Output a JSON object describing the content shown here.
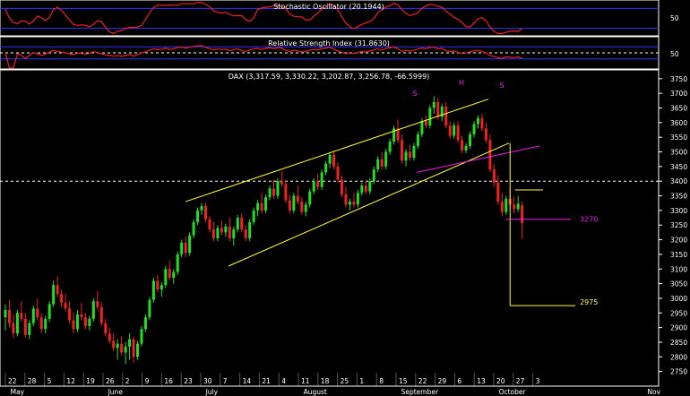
{
  "colors": {
    "background": "#000000",
    "up_candle": "#22dd22",
    "down_candle": "#ee2222",
    "trendline": "#ffff33",
    "neckline": "#ee22ee",
    "indicator_line": "#ee2222",
    "indicator_band": "#3333ff",
    "text": "#ffffff"
  },
  "chart_data": [
    {
      "type": "line",
      "title": "Stochastic Oscillator (20.1944)",
      "last_value": 20.1944,
      "ylim": [
        0,
        100
      ],
      "reference_levels": [
        20,
        80
      ],
      "ytick_labels": [
        "50"
      ]
    },
    {
      "type": "line",
      "title": "Relative Strength Index (31.8630)",
      "last_value": 31.863,
      "ylim": [
        0,
        100
      ],
      "reference_levels": [
        30,
        50,
        70
      ],
      "ytick_labels": [
        "50"
      ]
    },
    {
      "type": "candlestick",
      "title": "DAX (3,317.59, 3,330.22, 3,202.87, 3,256.78, -66.5999)",
      "last_bar": {
        "open": 3317.59,
        "high": 3330.22,
        "low": 3202.87,
        "close": 3256.78,
        "change": -66.5999
      },
      "ylim": [
        2700,
        3780
      ],
      "yticks": [
        2750,
        2800,
        2850,
        2900,
        2950,
        3000,
        3050,
        3100,
        3150,
        3200,
        3250,
        3300,
        3350,
        3400,
        3450,
        3500,
        3550,
        3600,
        3650,
        3700,
        3750
      ],
      "horizontal_reference": 3400,
      "x_day_labels": [
        "22",
        "28",
        "5",
        "12",
        "19",
        "26",
        "2",
        "9",
        "16",
        "23",
        "30",
        "7",
        "14",
        "21",
        "4",
        "11",
        "18",
        "25",
        "1",
        "8",
        "15",
        "22",
        "29",
        "6",
        "13",
        "20",
        "27",
        "3"
      ],
      "x_month_labels": [
        "May",
        "June",
        "July",
        "August",
        "September",
        "October",
        "Nov"
      ],
      "pattern_labels": [
        "S",
        "H",
        "S"
      ],
      "annotations": [
        {
          "label": "3270",
          "value": 3270
        },
        {
          "label": "2975",
          "value": 2975
        }
      ],
      "candles": [
        {
          "o": 2935,
          "h": 2980,
          "l": 2890,
          "c": 2960
        },
        {
          "o": 2960,
          "h": 2995,
          "l": 2900,
          "c": 2915
        },
        {
          "o": 2915,
          "h": 2945,
          "l": 2865,
          "c": 2880
        },
        {
          "o": 2880,
          "h": 2960,
          "l": 2870,
          "c": 2950
        },
        {
          "o": 2950,
          "h": 2990,
          "l": 2920,
          "c": 2930
        },
        {
          "o": 2930,
          "h": 2950,
          "l": 2865,
          "c": 2875
        },
        {
          "o": 2875,
          "h": 2925,
          "l": 2860,
          "c": 2915
        },
        {
          "o": 2915,
          "h": 2975,
          "l": 2905,
          "c": 2965
        },
        {
          "o": 2965,
          "h": 3000,
          "l": 2925,
          "c": 2935
        },
        {
          "o": 2935,
          "h": 2950,
          "l": 2880,
          "c": 2895
        },
        {
          "o": 2895,
          "h": 2940,
          "l": 2880,
          "c": 2930
        },
        {
          "o": 2930,
          "h": 2990,
          "l": 2920,
          "c": 2980
        },
        {
          "o": 2980,
          "h": 3060,
          "l": 2970,
          "c": 3045
        },
        {
          "o": 3045,
          "h": 3075,
          "l": 3005,
          "c": 3015
        },
        {
          "o": 3015,
          "h": 3030,
          "l": 2970,
          "c": 2985
        },
        {
          "o": 2985,
          "h": 3015,
          "l": 2955,
          "c": 2965
        },
        {
          "o": 2965,
          "h": 2990,
          "l": 2915,
          "c": 2925
        },
        {
          "o": 2925,
          "h": 2950,
          "l": 2880,
          "c": 2895
        },
        {
          "o": 2895,
          "h": 2960,
          "l": 2885,
          "c": 2945
        },
        {
          "o": 2945,
          "h": 2985,
          "l": 2925,
          "c": 2935
        },
        {
          "o": 2935,
          "h": 2950,
          "l": 2895,
          "c": 2905
        },
        {
          "o": 2905,
          "h": 2940,
          "l": 2890,
          "c": 2930
        },
        {
          "o": 2930,
          "h": 3000,
          "l": 2920,
          "c": 2990
        },
        {
          "o": 2990,
          "h": 3025,
          "l": 2960,
          "c": 2970
        },
        {
          "o": 2970,
          "h": 2985,
          "l": 2905,
          "c": 2915
        },
        {
          "o": 2915,
          "h": 2930,
          "l": 2870,
          "c": 2880
        },
        {
          "o": 2880,
          "h": 2900,
          "l": 2845,
          "c": 2855
        },
        {
          "o": 2855,
          "h": 2880,
          "l": 2820,
          "c": 2830
        },
        {
          "o": 2830,
          "h": 2860,
          "l": 2790,
          "c": 2845
        },
        {
          "o": 2845,
          "h": 2870,
          "l": 2805,
          "c": 2815
        },
        {
          "o": 2815,
          "h": 2850,
          "l": 2775,
          "c": 2835
        },
        {
          "o": 2835,
          "h": 2880,
          "l": 2790,
          "c": 2860
        },
        {
          "o": 2860,
          "h": 2870,
          "l": 2780,
          "c": 2800
        },
        {
          "o": 2800,
          "h": 2855,
          "l": 2790,
          "c": 2845
        },
        {
          "o": 2845,
          "h": 2905,
          "l": 2835,
          "c": 2895
        },
        {
          "o": 2895,
          "h": 2945,
          "l": 2885,
          "c": 2935
        },
        {
          "o": 2935,
          "h": 3005,
          "l": 2925,
          "c": 2995
        },
        {
          "o": 2995,
          "h": 3070,
          "l": 2985,
          "c": 3060
        },
        {
          "o": 3060,
          "h": 3080,
          "l": 3020,
          "c": 3030
        },
        {
          "o": 3030,
          "h": 3055,
          "l": 3005,
          "c": 3045
        },
        {
          "o": 3045,
          "h": 3110,
          "l": 3035,
          "c": 3100
        },
        {
          "o": 3100,
          "h": 3130,
          "l": 3060,
          "c": 3070
        },
        {
          "o": 3070,
          "h": 3100,
          "l": 3050,
          "c": 3090
        },
        {
          "o": 3090,
          "h": 3160,
          "l": 3080,
          "c": 3150
        },
        {
          "o": 3150,
          "h": 3200,
          "l": 3140,
          "c": 3190
        },
        {
          "o": 3190,
          "h": 3210,
          "l": 3140,
          "c": 3155
        },
        {
          "o": 3155,
          "h": 3225,
          "l": 3145,
          "c": 3215
        },
        {
          "o": 3215,
          "h": 3270,
          "l": 3205,
          "c": 3260
        },
        {
          "o": 3260,
          "h": 3310,
          "l": 3250,
          "c": 3300
        },
        {
          "o": 3300,
          "h": 3325,
          "l": 3285,
          "c": 3315
        },
        {
          "o": 3315,
          "h": 3325,
          "l": 3260,
          "c": 3270
        },
        {
          "o": 3270,
          "h": 3280,
          "l": 3225,
          "c": 3235
        },
        {
          "o": 3235,
          "h": 3260,
          "l": 3195,
          "c": 3205
        },
        {
          "o": 3205,
          "h": 3250,
          "l": 3195,
          "c": 3240
        },
        {
          "o": 3240,
          "h": 3265,
          "l": 3215,
          "c": 3225
        },
        {
          "o": 3225,
          "h": 3255,
          "l": 3210,
          "c": 3245
        },
        {
          "o": 3245,
          "h": 3275,
          "l": 3195,
          "c": 3205
        },
        {
          "o": 3205,
          "h": 3245,
          "l": 3180,
          "c": 3235
        },
        {
          "o": 3235,
          "h": 3285,
          "l": 3225,
          "c": 3275
        },
        {
          "o": 3275,
          "h": 3290,
          "l": 3225,
          "c": 3235
        },
        {
          "o": 3235,
          "h": 3250,
          "l": 3195,
          "c": 3205
        },
        {
          "o": 3205,
          "h": 3270,
          "l": 3195,
          "c": 3260
        },
        {
          "o": 3260,
          "h": 3310,
          "l": 3250,
          "c": 3300
        },
        {
          "o": 3300,
          "h": 3335,
          "l": 3280,
          "c": 3325
        },
        {
          "o": 3325,
          "h": 3360,
          "l": 3290,
          "c": 3300
        },
        {
          "o": 3300,
          "h": 3355,
          "l": 3290,
          "c": 3345
        },
        {
          "o": 3345,
          "h": 3385,
          "l": 3335,
          "c": 3375
        },
        {
          "o": 3375,
          "h": 3405,
          "l": 3340,
          "c": 3350
        },
        {
          "o": 3350,
          "h": 3410,
          "l": 3340,
          "c": 3400
        },
        {
          "o": 3400,
          "h": 3435,
          "l": 3380,
          "c": 3390
        },
        {
          "o": 3390,
          "h": 3405,
          "l": 3325,
          "c": 3335
        },
        {
          "o": 3335,
          "h": 3355,
          "l": 3290,
          "c": 3300
        },
        {
          "o": 3300,
          "h": 3360,
          "l": 3290,
          "c": 3350
        },
        {
          "o": 3350,
          "h": 3385,
          "l": 3320,
          "c": 3330
        },
        {
          "o": 3330,
          "h": 3345,
          "l": 3285,
          "c": 3295
        },
        {
          "o": 3295,
          "h": 3330,
          "l": 3280,
          "c": 3320
        },
        {
          "o": 3320,
          "h": 3375,
          "l": 3310,
          "c": 3365
        },
        {
          "o": 3365,
          "h": 3410,
          "l": 3355,
          "c": 3400
        },
        {
          "o": 3400,
          "h": 3425,
          "l": 3370,
          "c": 3380
        },
        {
          "o": 3380,
          "h": 3440,
          "l": 3370,
          "c": 3430
        },
        {
          "o": 3430,
          "h": 3470,
          "l": 3420,
          "c": 3460
        },
        {
          "o": 3460,
          "h": 3500,
          "l": 3445,
          "c": 3490
        },
        {
          "o": 3490,
          "h": 3505,
          "l": 3440,
          "c": 3450
        },
        {
          "o": 3450,
          "h": 3465,
          "l": 3395,
          "c": 3405
        },
        {
          "o": 3405,
          "h": 3420,
          "l": 3345,
          "c": 3355
        },
        {
          "o": 3355,
          "h": 3380,
          "l": 3310,
          "c": 3320
        },
        {
          "o": 3320,
          "h": 3340,
          "l": 3300,
          "c": 3330
        },
        {
          "o": 3330,
          "h": 3360,
          "l": 3310,
          "c": 3320
        },
        {
          "o": 3320,
          "h": 3370,
          "l": 3310,
          "c": 3360
        },
        {
          "o": 3360,
          "h": 3395,
          "l": 3350,
          "c": 3385
        },
        {
          "o": 3385,
          "h": 3400,
          "l": 3355,
          "c": 3365
        },
        {
          "o": 3365,
          "h": 3410,
          "l": 3355,
          "c": 3400
        },
        {
          "o": 3400,
          "h": 3450,
          "l": 3390,
          "c": 3440
        },
        {
          "o": 3440,
          "h": 3485,
          "l": 3430,
          "c": 3475
        },
        {
          "o": 3475,
          "h": 3500,
          "l": 3440,
          "c": 3450
        },
        {
          "o": 3450,
          "h": 3510,
          "l": 3440,
          "c": 3500
        },
        {
          "o": 3500,
          "h": 3545,
          "l": 3490,
          "c": 3535
        },
        {
          "o": 3535,
          "h": 3590,
          "l": 3525,
          "c": 3580
        },
        {
          "o": 3580,
          "h": 3610,
          "l": 3530,
          "c": 3540
        },
        {
          "o": 3540,
          "h": 3560,
          "l": 3460,
          "c": 3470
        },
        {
          "o": 3470,
          "h": 3510,
          "l": 3450,
          "c": 3500
        },
        {
          "o": 3500,
          "h": 3525,
          "l": 3470,
          "c": 3480
        },
        {
          "o": 3480,
          "h": 3530,
          "l": 3470,
          "c": 3520
        },
        {
          "o": 3520,
          "h": 3570,
          "l": 3510,
          "c": 3560
        },
        {
          "o": 3560,
          "h": 3615,
          "l": 3550,
          "c": 3605
        },
        {
          "o": 3605,
          "h": 3625,
          "l": 3580,
          "c": 3590
        },
        {
          "o": 3590,
          "h": 3660,
          "l": 3580,
          "c": 3650
        },
        {
          "o": 3650,
          "h": 3690,
          "l": 3630,
          "c": 3670
        },
        {
          "o": 3670,
          "h": 3685,
          "l": 3610,
          "c": 3620
        },
        {
          "o": 3620,
          "h": 3665,
          "l": 3605,
          "c": 3655
        },
        {
          "o": 3655,
          "h": 3670,
          "l": 3580,
          "c": 3590
        },
        {
          "o": 3590,
          "h": 3605,
          "l": 3545,
          "c": 3555
        },
        {
          "o": 3555,
          "h": 3600,
          "l": 3545,
          "c": 3590
        },
        {
          "o": 3590,
          "h": 3605,
          "l": 3530,
          "c": 3540
        },
        {
          "o": 3540,
          "h": 3555,
          "l": 3495,
          "c": 3505
        },
        {
          "o": 3505,
          "h": 3530,
          "l": 3495,
          "c": 3520
        },
        {
          "o": 3520,
          "h": 3570,
          "l": 3510,
          "c": 3560
        },
        {
          "o": 3560,
          "h": 3605,
          "l": 3550,
          "c": 3595
        },
        {
          "o": 3595,
          "h": 3625,
          "l": 3580,
          "c": 3615
        },
        {
          "o": 3615,
          "h": 3630,
          "l": 3570,
          "c": 3580
        },
        {
          "o": 3580,
          "h": 3600,
          "l": 3530,
          "c": 3540
        },
        {
          "o": 3540,
          "h": 3560,
          "l": 3430,
          "c": 3440
        },
        {
          "o": 3440,
          "h": 3460,
          "l": 3380,
          "c": 3395
        },
        {
          "o": 3395,
          "h": 3420,
          "l": 3320,
          "c": 3330
        },
        {
          "o": 3330,
          "h": 3360,
          "l": 3280,
          "c": 3295
        },
        {
          "o": 3295,
          "h": 3350,
          "l": 3285,
          "c": 3340
        },
        {
          "o": 3340,
          "h": 3375,
          "l": 3310,
          "c": 3320
        },
        {
          "o": 3320,
          "h": 3345,
          "l": 3290,
          "c": 3305
        },
        {
          "o": 3305,
          "h": 3350,
          "l": 3295,
          "c": 3323
        },
        {
          "o": 3317.59,
          "h": 3330.22,
          "l": 3202.87,
          "c": 3256.78
        }
      ]
    }
  ]
}
